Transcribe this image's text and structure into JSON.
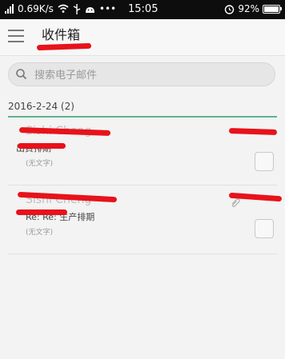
{
  "status_bar": {
    "speed": "0.69K/s",
    "time": "15:05",
    "battery": "92%"
  },
  "header": {
    "title": "收件箱",
    "menu_icon": "hamburger-menu-icon"
  },
  "search": {
    "placeholder": "搜索电子邮件",
    "value": ""
  },
  "groups": [
    {
      "date_label": "2016-2-24 (2)",
      "emails": [
        {
          "sender": "Sishi Cheng",
          "subject": "出貨排期",
          "preview": "(无文字)",
          "checked": false
        },
        {
          "sender": "Sishi Cheng",
          "subject": "Re: Re: 生产排期",
          "preview": "(无文字)",
          "checked": false,
          "has_attachment": true
        }
      ]
    }
  ],
  "colors": {
    "accent_green": "#5fb38d",
    "redaction_red": "#e8121a",
    "status_bar_bg": "#0d0d0d"
  }
}
